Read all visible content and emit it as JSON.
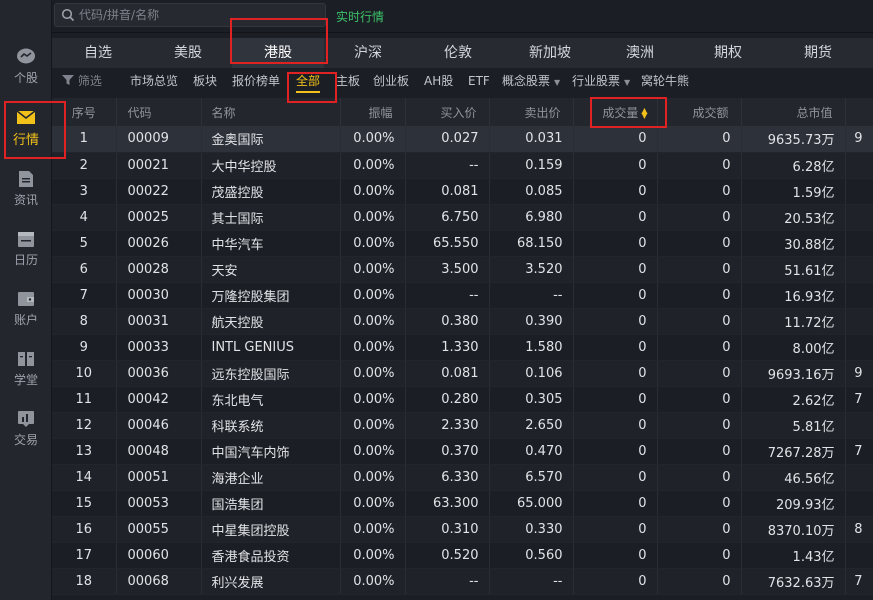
{
  "search": {
    "placeholder": "代码/拼音/名称"
  },
  "realtime_label": "实时行情",
  "sidebar": {
    "items": [
      {
        "label": "个股",
        "icon": "chat-bubble-icon"
      },
      {
        "label": "行情",
        "icon": "envelope-icon"
      },
      {
        "label": "资讯",
        "icon": "document-icon"
      },
      {
        "label": "日历",
        "icon": "calendar-icon"
      },
      {
        "label": "账户",
        "icon": "wallet-icon"
      },
      {
        "label": "学堂",
        "icon": "book-icon"
      },
      {
        "label": "交易",
        "icon": "chart-box-icon"
      }
    ],
    "active_index": 1
  },
  "market_tabs": [
    "自选",
    "美股",
    "港股",
    "沪深",
    "伦敦",
    "新加坡",
    "澳洲",
    "期权",
    "期货"
  ],
  "market_active_index": 2,
  "sub_tabs": {
    "filter_label": "筛选",
    "items": [
      "市场总览",
      "板块",
      "报价榜单",
      "全部",
      "主板",
      "创业板",
      "AH股",
      "ETF",
      "概念股票",
      "行业股票",
      "窝轮牛熊"
    ],
    "dropdown_items": [
      "概念股票",
      "行业股票"
    ],
    "active_label": "全部"
  },
  "table": {
    "columns": [
      "序号",
      "代码",
      "名称",
      "振幅",
      "买入价",
      "卖出价",
      "成交量",
      "成交额",
      "总市值"
    ],
    "sorted_column": "成交量",
    "rows": [
      [
        "1",
        "00009",
        "金奥国际",
        "0.00%",
        "0.027",
        "0.031",
        "0",
        "0",
        "9635.73万",
        "9"
      ],
      [
        "2",
        "00021",
        "大中华控股",
        "0.00%",
        "--",
        "0.159",
        "0",
        "0",
        "6.28亿",
        ""
      ],
      [
        "3",
        "00022",
        "茂盛控股",
        "0.00%",
        "0.081",
        "0.085",
        "0",
        "0",
        "1.59亿",
        ""
      ],
      [
        "4",
        "00025",
        "其士国际",
        "0.00%",
        "6.750",
        "6.980",
        "0",
        "0",
        "20.53亿",
        ""
      ],
      [
        "5",
        "00026",
        "中华汽车",
        "0.00%",
        "65.550",
        "68.150",
        "0",
        "0",
        "30.88亿",
        ""
      ],
      [
        "6",
        "00028",
        "天安",
        "0.00%",
        "3.500",
        "3.520",
        "0",
        "0",
        "51.61亿",
        ""
      ],
      [
        "7",
        "00030",
        "万隆控股集团",
        "0.00%",
        "--",
        "--",
        "0",
        "0",
        "16.93亿",
        ""
      ],
      [
        "8",
        "00031",
        "航天控股",
        "0.00%",
        "0.380",
        "0.390",
        "0",
        "0",
        "11.72亿",
        ""
      ],
      [
        "9",
        "00033",
        "INTL GENIUS",
        "0.00%",
        "1.330",
        "1.580",
        "0",
        "0",
        "8.00亿",
        ""
      ],
      [
        "10",
        "00036",
        "远东控股国际",
        "0.00%",
        "0.081",
        "0.106",
        "0",
        "0",
        "9693.16万",
        "9"
      ],
      [
        "11",
        "00042",
        "东北电气",
        "0.00%",
        "0.280",
        "0.305",
        "0",
        "0",
        "2.62亿",
        "7"
      ],
      [
        "12",
        "00046",
        "科联系统",
        "0.00%",
        "2.330",
        "2.650",
        "0",
        "0",
        "5.81亿",
        ""
      ],
      [
        "13",
        "00048",
        "中国汽车内饰",
        "0.00%",
        "0.370",
        "0.470",
        "0",
        "0",
        "7267.28万",
        "7"
      ],
      [
        "14",
        "00051",
        "海港企业",
        "0.00%",
        "6.330",
        "6.570",
        "0",
        "0",
        "46.56亿",
        ""
      ],
      [
        "15",
        "00053",
        "国浩集团",
        "0.00%",
        "63.300",
        "65.000",
        "0",
        "0",
        "209.93亿",
        ""
      ],
      [
        "16",
        "00055",
        "中星集团控股",
        "0.00%",
        "0.310",
        "0.330",
        "0",
        "0",
        "8370.10万",
        "8"
      ],
      [
        "17",
        "00060",
        "香港食品投资",
        "0.00%",
        "0.520",
        "0.560",
        "0",
        "0",
        "1.43亿",
        ""
      ],
      [
        "18",
        "00068",
        "利兴发展",
        "0.00%",
        "--",
        "--",
        "0",
        "0",
        "7632.63万",
        "7"
      ]
    ]
  },
  "colors": {
    "accent": "#f3c21a",
    "realtime": "#3cc26a",
    "highlight": "#e02222"
  }
}
